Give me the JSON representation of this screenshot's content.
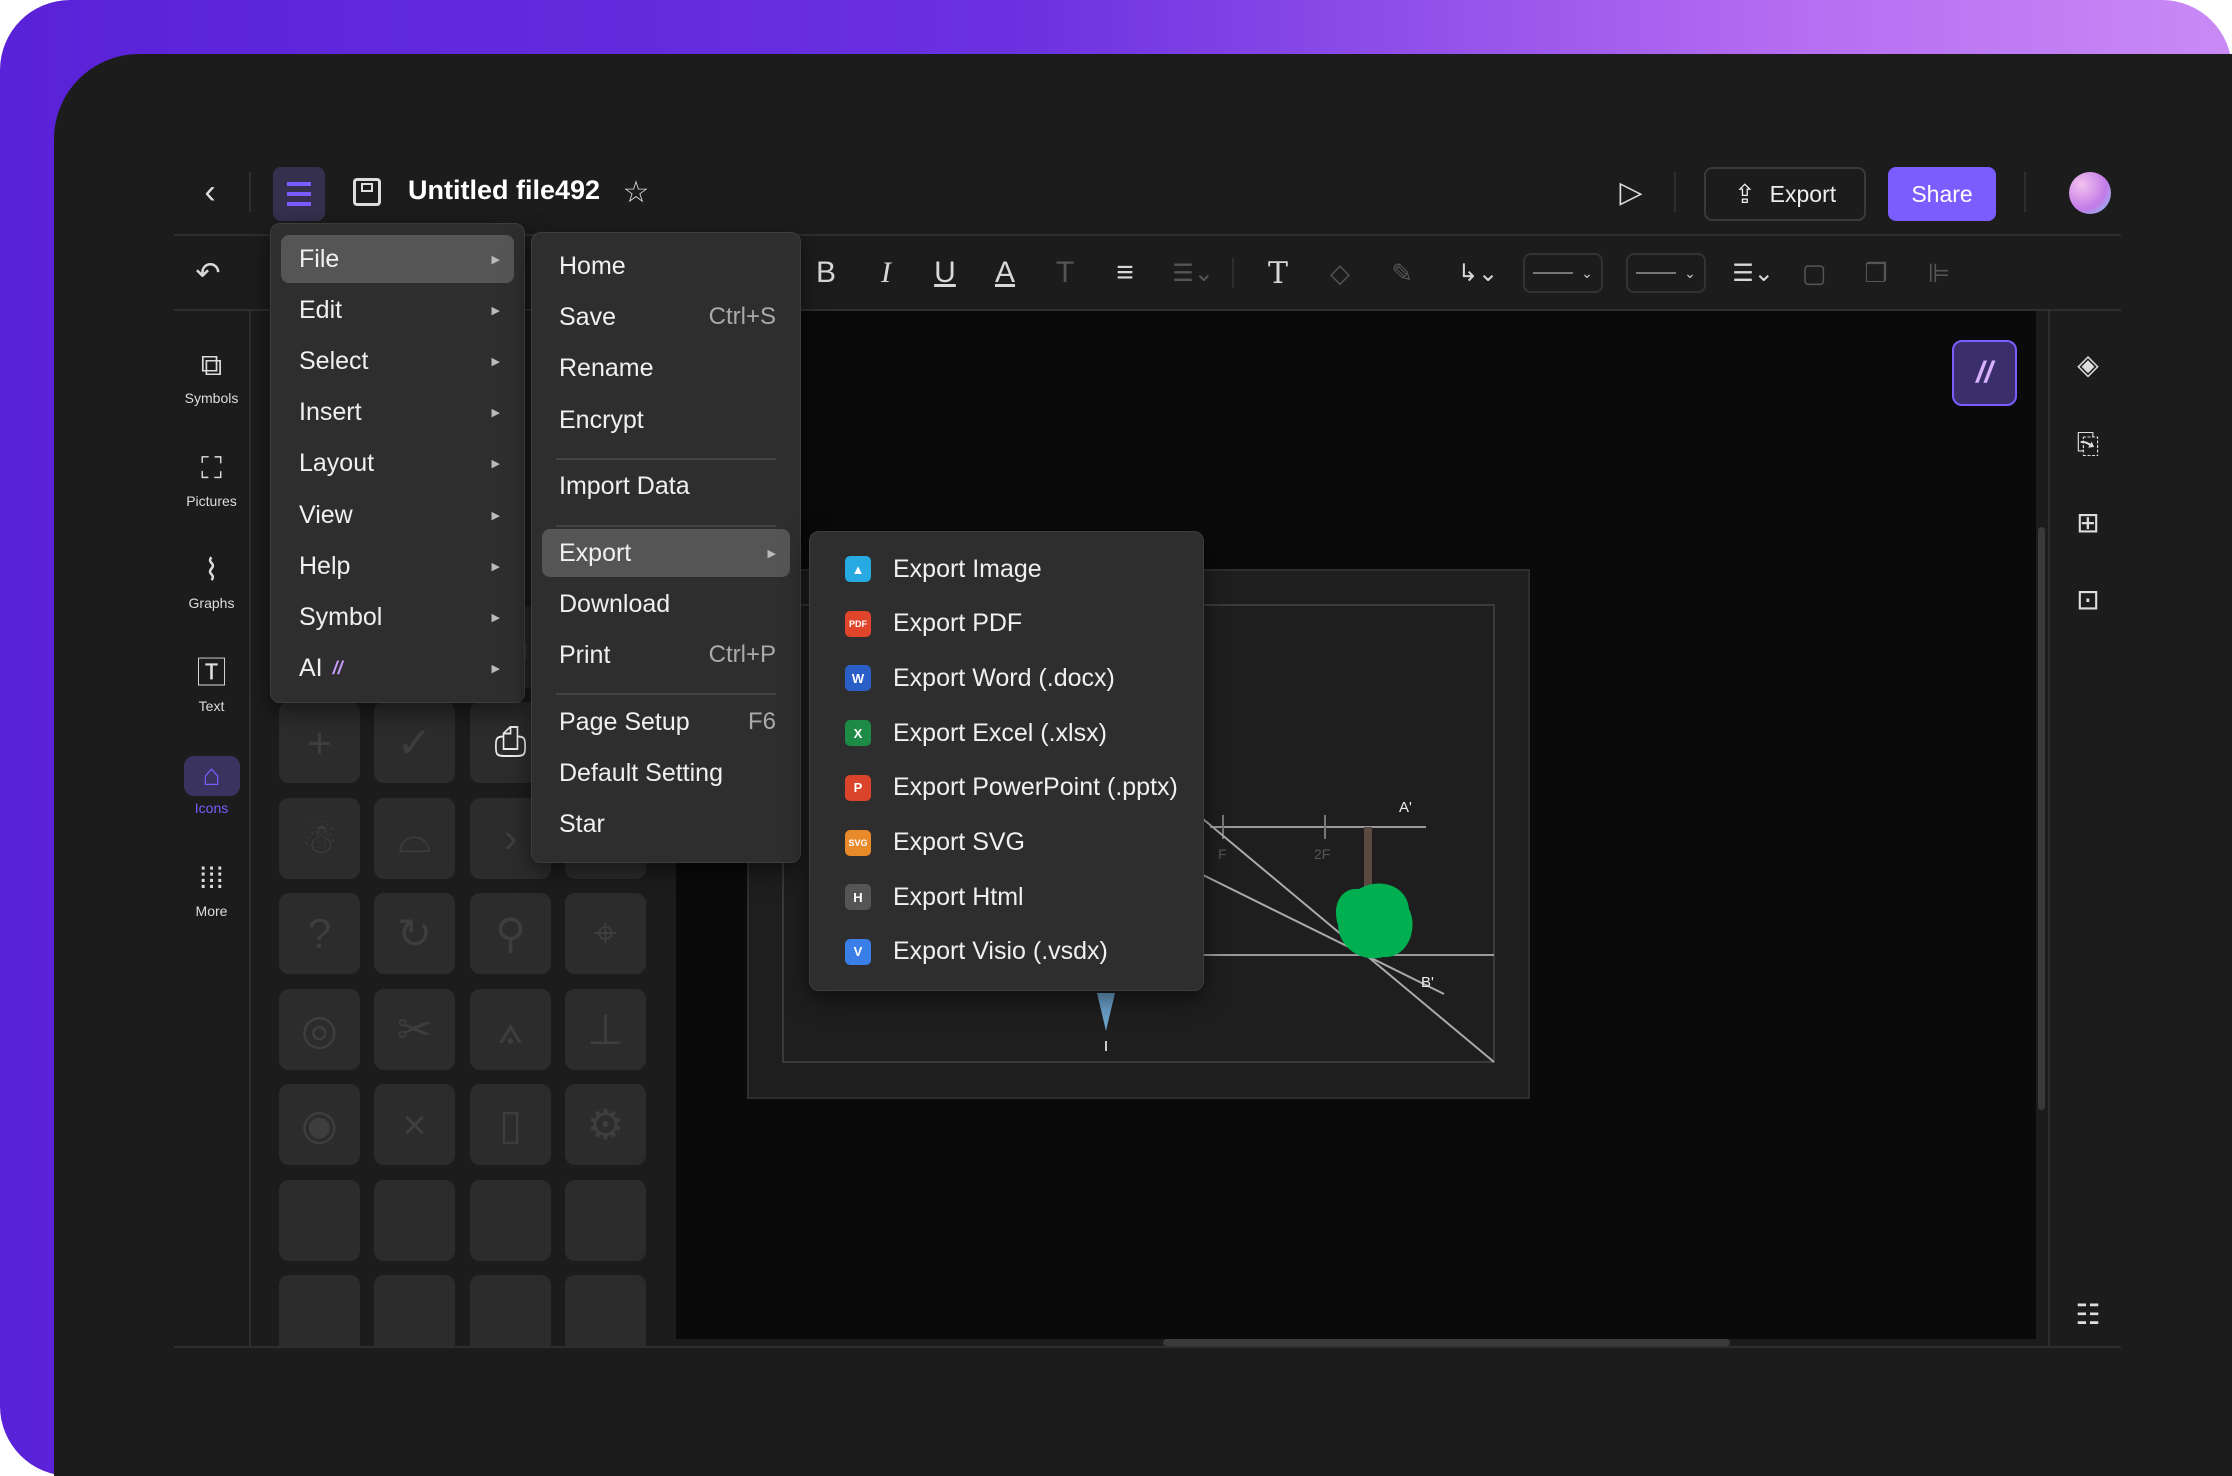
{
  "header": {
    "title": "Untitled file492",
    "export_label": "Export",
    "share_label": "Share"
  },
  "sidebar": {
    "items": [
      {
        "label": "Symbols",
        "icon": "symbols-icon"
      },
      {
        "label": "Pictures",
        "icon": "pictures-icon"
      },
      {
        "label": "Graphs",
        "icon": "graphs-icon"
      },
      {
        "label": "Text",
        "icon": "text-icon"
      },
      {
        "label": "Icons",
        "icon": "icons-icon",
        "active": true
      },
      {
        "label": "More",
        "icon": "more-icon"
      }
    ]
  },
  "icon_grid": [
    "contact-card",
    "building",
    "card",
    "",
    "plus",
    "check",
    "contact-card",
    "home",
    "penguin",
    "shop",
    "chevron-right",
    "qr-code",
    "help",
    "refresh",
    "search",
    "location",
    "camera",
    "scissors",
    "compass",
    "stamp",
    "disc",
    "close",
    "bottle",
    "wheel"
  ],
  "main_menu": {
    "items": [
      {
        "label": "File",
        "active": true
      },
      {
        "label": "Edit"
      },
      {
        "label": "Select"
      },
      {
        "label": "Insert"
      },
      {
        "label": "Layout"
      },
      {
        "label": "View"
      },
      {
        "label": "Help"
      },
      {
        "label": "Symbol"
      },
      {
        "label": "AI"
      }
    ]
  },
  "file_menu": {
    "items": [
      {
        "label": "Home"
      },
      {
        "label": "Save",
        "shortcut": "Ctrl+S"
      },
      {
        "label": "Rename"
      },
      {
        "label": "Encrypt"
      },
      {
        "label": "Import Data"
      },
      {
        "label": "Export",
        "active": true
      },
      {
        "label": "Download"
      },
      {
        "label": "Print",
        "shortcut": "Ctrl+P"
      },
      {
        "label": "Page Setup",
        "shortcut": "F6"
      },
      {
        "label": "Default Setting"
      },
      {
        "label": "Star"
      }
    ]
  },
  "export_menu": {
    "items": [
      {
        "label": "Export Image",
        "badge": "▲",
        "color": "#27a9e1"
      },
      {
        "label": "Export PDF",
        "badge": "PDF",
        "color": "#e0452b"
      },
      {
        "label": "Export Word (.docx)",
        "badge": "W",
        "color": "#2b5fc8"
      },
      {
        "label": "Export Excel (.xlsx)",
        "badge": "X",
        "color": "#1d8a45"
      },
      {
        "label": "Export PowerPoint (.pptx)",
        "badge": "P",
        "color": "#d9442a"
      },
      {
        "label": "Export SVG",
        "badge": "SVG",
        "color": "#e88a2a"
      },
      {
        "label": "Export Html",
        "badge": "H",
        "color": "#555555"
      },
      {
        "label": "Export Visio (.vsdx)",
        "badge": "V",
        "color": "#3a7ee8"
      }
    ]
  },
  "diagram": {
    "labels": {
      "a_prime": "A'",
      "b_prime": "B'",
      "f": "F",
      "two_f": "2F"
    }
  },
  "colors": {
    "accent": "#7b5cff",
    "share": "#7b5cff",
    "tree": "#00b050"
  }
}
